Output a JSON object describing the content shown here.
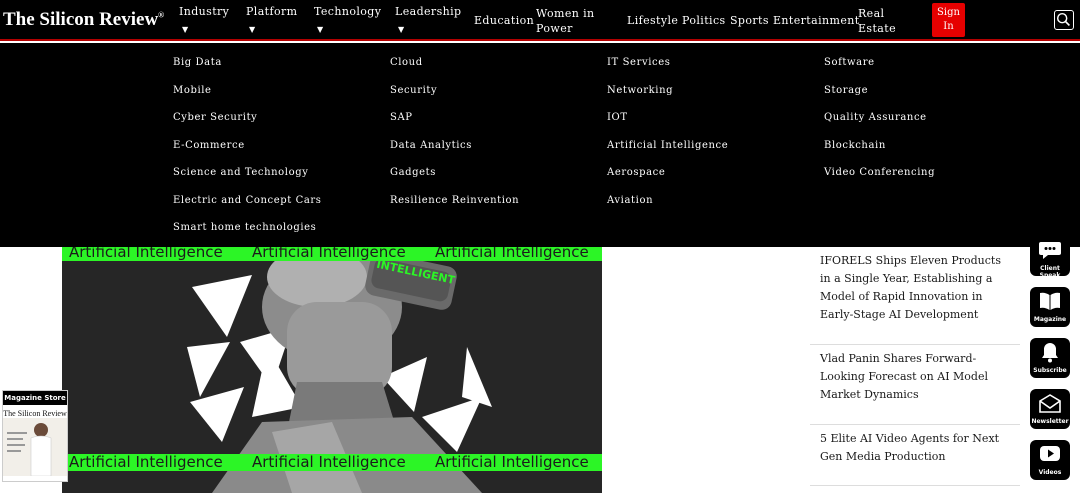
{
  "header": {
    "logo": "The Silicon Review",
    "logo_mark": "®",
    "nav": {
      "industry": "Industry",
      "platform": "Platform",
      "technology": "Technology",
      "leadership": "Leadership",
      "education": "Education",
      "women_line1": "Women in",
      "women_line2": "Power",
      "lifestyle": "Lifestyle",
      "politics": "Politics",
      "sports": "Sports",
      "entertainment": "Entertainment",
      "realestate_line1": "Real",
      "realestate_line2": "Estate"
    },
    "signin_line1": "Sign",
    "signin_line2": "In",
    "caret": "▼"
  },
  "mega_menu": {
    "col1": [
      "Big Data",
      "Mobile",
      "Cyber Security",
      "E-Commerce",
      "Science and Technology",
      "Electric and Concept Cars",
      "Smart home technologies"
    ],
    "col2": [
      "Cloud",
      "Security",
      "SAP",
      "Data Analytics",
      "Gadgets",
      "Resilience Reinvention"
    ],
    "col3": [
      "IT Services",
      "Networking",
      "IOT",
      "Artificial Intelligence",
      "Aerospace",
      "Aviation"
    ],
    "col4": [
      "Software",
      "Storage",
      "Quality Assurance",
      "Blockchain",
      "Video Conferencing"
    ]
  },
  "hero": {
    "band_text": "Artificial Intelligence",
    "headset_text": "INTELLIGENT"
  },
  "news": [
    "IFORELS Ships Eleven Products in a Single Year, Establishing a Model of Rapid Innovation in Early-Stage AI Development",
    "Vlad Panin Shares Forward-Looking Forecast on AI Model Market Dynamics",
    "5 Elite AI Video Agents for Next Gen Media Production"
  ],
  "side_icons": {
    "client_speak": "Client Speak",
    "magazine": "Magazine",
    "subscribe": "Subscribe",
    "newsletter": "Newsletter",
    "videos": "Videos"
  },
  "magazine_store": {
    "label": "Magazine Store",
    "cover_title": "The Silicon Review"
  },
  "colors": {
    "header_bg": "#000000",
    "accent_red": "#e60000",
    "ai_green": "#2cf526"
  }
}
